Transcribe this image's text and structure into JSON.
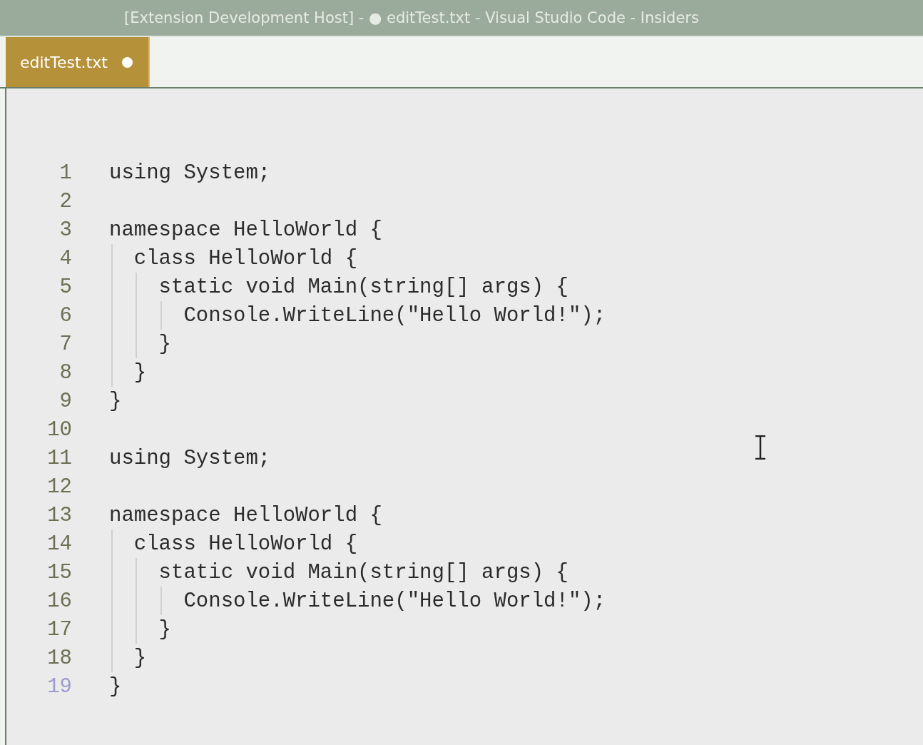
{
  "window": {
    "title": "[Extension Development Host] - ● editTest.txt - Visual Studio Code - Insiders"
  },
  "tabs": [
    {
      "label": "editTest.txt",
      "modified": true,
      "selected": true
    }
  ],
  "editor": {
    "lines": [
      {
        "number": "1",
        "text": "using System;",
        "current": false
      },
      {
        "number": "2",
        "current": false
      },
      {
        "number": "3",
        "text": "namespace HelloWorld {",
        "current": false
      },
      {
        "number": "4",
        "text": "  class HelloWorld {",
        "current": false
      },
      {
        "number": "5",
        "text": "    static void Main(string[] args) {",
        "current": false
      },
      {
        "number": "6",
        "text": "      Console.WriteLine(\"Hello World!\");",
        "current": false
      },
      {
        "number": "7",
        "text": "    }",
        "current": false
      },
      {
        "number": "8",
        "text": "  }",
        "current": false
      },
      {
        "number": "9",
        "text": "}",
        "current": false
      },
      {
        "number": "10",
        "current": false
      },
      {
        "number": "11",
        "text": "using System;",
        "current": false
      },
      {
        "number": "12",
        "current": false
      },
      {
        "number": "13",
        "text": "namespace HelloWorld {",
        "current": false
      },
      {
        "number": "14",
        "text": "  class HelloWorld {",
        "current": false
      },
      {
        "number": "15",
        "text": "    static void Main(string[] args) {",
        "current": false
      },
      {
        "number": "16",
        "text": "      Console.WriteLine(\"Hello World!\");",
        "current": false
      },
      {
        "number": "17",
        "text": "    }",
        "current": false
      },
      {
        "number": "18",
        "text": "  }",
        "current": false
      },
      {
        "number": "19",
        "text": "}",
        "current": true
      }
    ]
  }
}
